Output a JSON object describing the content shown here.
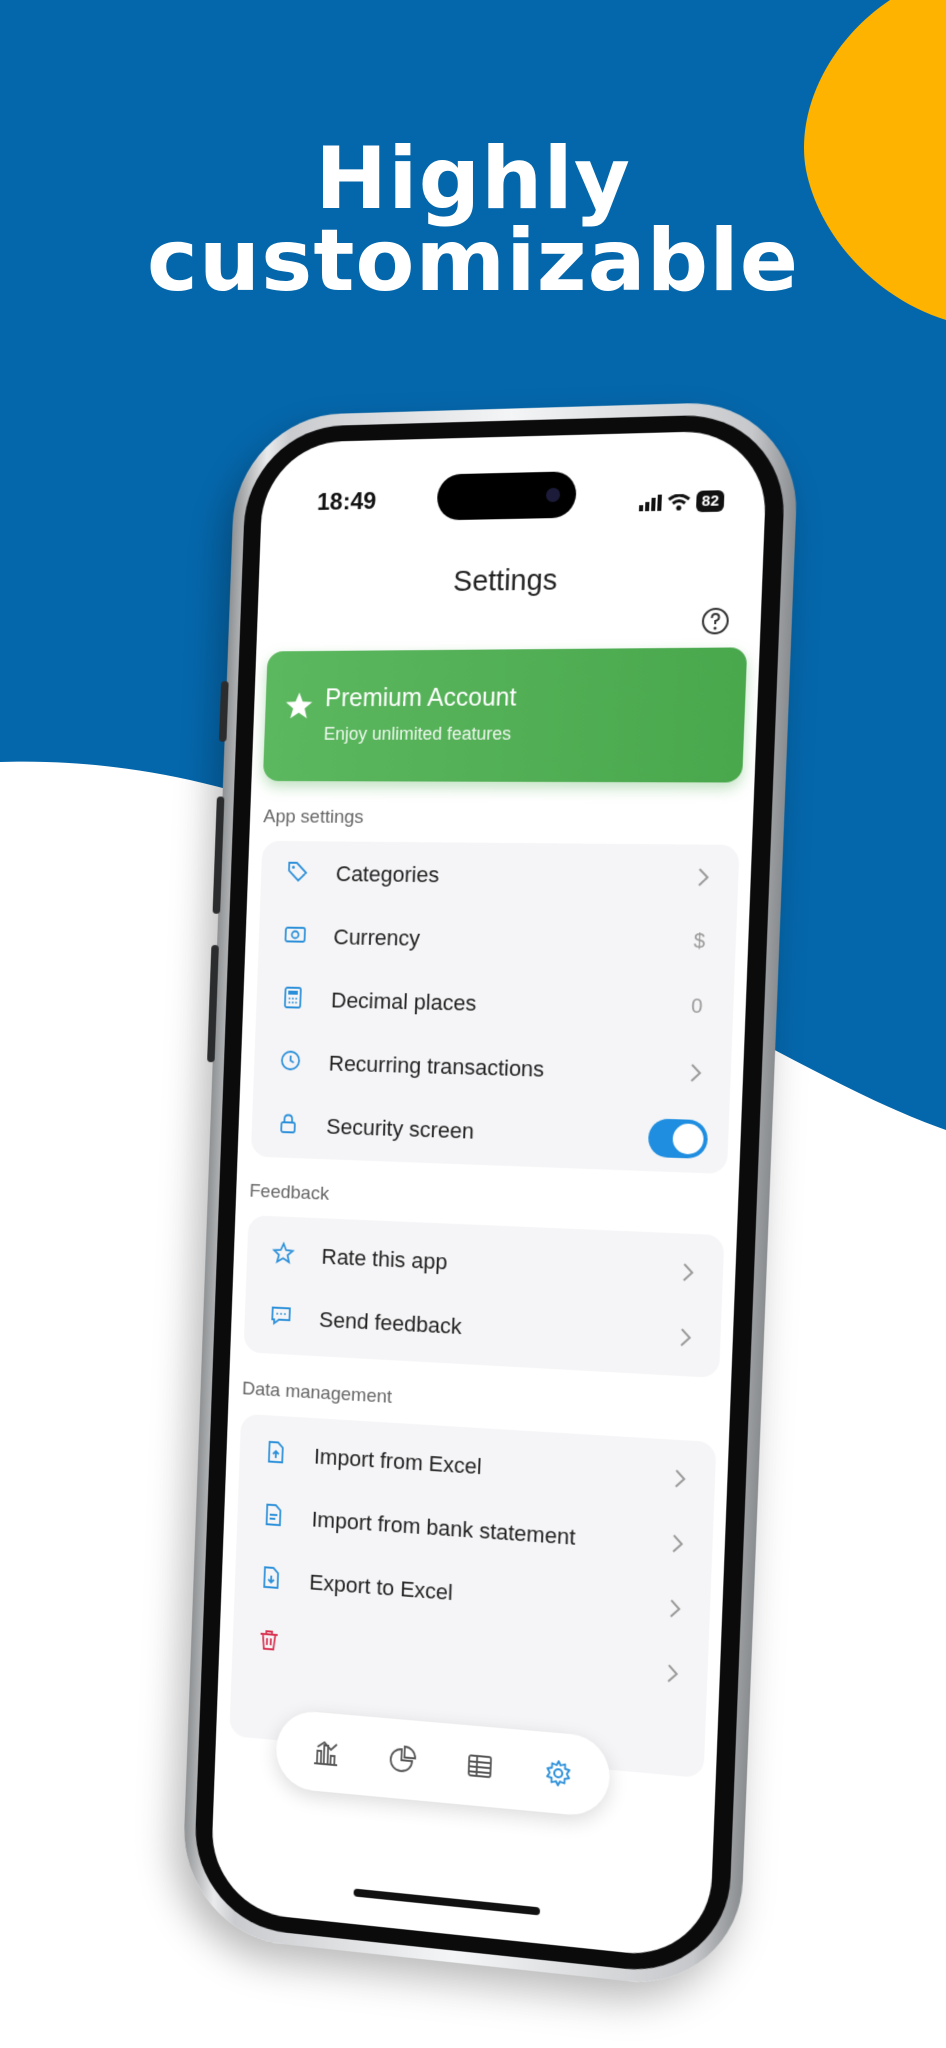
{
  "headline": {
    "line1": "Highly",
    "line2": "customizable"
  },
  "colors": {
    "brand_blue": "#0467ac",
    "accent_yellow": "#fdb300",
    "premium_green": "#55b058",
    "toggle_blue": "#1f8ee0",
    "icon_blue": "#2a8fd9",
    "danger_red": "#d9304f"
  },
  "status_bar": {
    "time": "18:49",
    "battery": "82",
    "icons": [
      "cellular-icon",
      "wifi-icon",
      "battery-icon"
    ]
  },
  "header": {
    "title": "Settings",
    "help_icon": "help-icon"
  },
  "premium": {
    "title": "Premium Account",
    "subtitle": "Enjoy unlimited features",
    "icon": "star-icon"
  },
  "app_settings": {
    "label": "App settings",
    "items": [
      {
        "label": "Categories",
        "icon": "tag-icon",
        "trailing": "chevron"
      },
      {
        "label": "Currency",
        "icon": "currency-icon",
        "value": "$"
      },
      {
        "label": "Decimal places",
        "icon": "calculator-icon",
        "value": "0"
      },
      {
        "label": "Recurring transactions",
        "icon": "clock-icon",
        "trailing": "chevron"
      },
      {
        "label": "Security screen",
        "icon": "lock-icon",
        "trailing": "toggle",
        "enabled": true
      }
    ]
  },
  "feedback": {
    "label": "Feedback",
    "items": [
      {
        "label": "Rate this app",
        "icon": "star-outline-icon",
        "trailing": "chevron"
      },
      {
        "label": "Send feedback",
        "icon": "chat-icon",
        "trailing": "chevron"
      }
    ]
  },
  "data_management": {
    "label": "Data management",
    "items": [
      {
        "label": "Import from Excel",
        "icon": "file-import-icon",
        "trailing": "chevron"
      },
      {
        "label": "Import from bank statement",
        "icon": "file-text-icon",
        "trailing": "chevron"
      },
      {
        "label": "Export to Excel",
        "icon": "file-export-icon",
        "trailing": "chevron"
      },
      {
        "label": "",
        "icon": "trash-icon",
        "trailing": "chevron"
      }
    ]
  },
  "tab_bar": {
    "tabs": [
      {
        "icon": "bar-chart-icon",
        "active": false
      },
      {
        "icon": "pie-chart-icon",
        "active": false
      },
      {
        "icon": "table-icon",
        "active": false
      },
      {
        "icon": "settings-icon",
        "active": true
      }
    ]
  }
}
